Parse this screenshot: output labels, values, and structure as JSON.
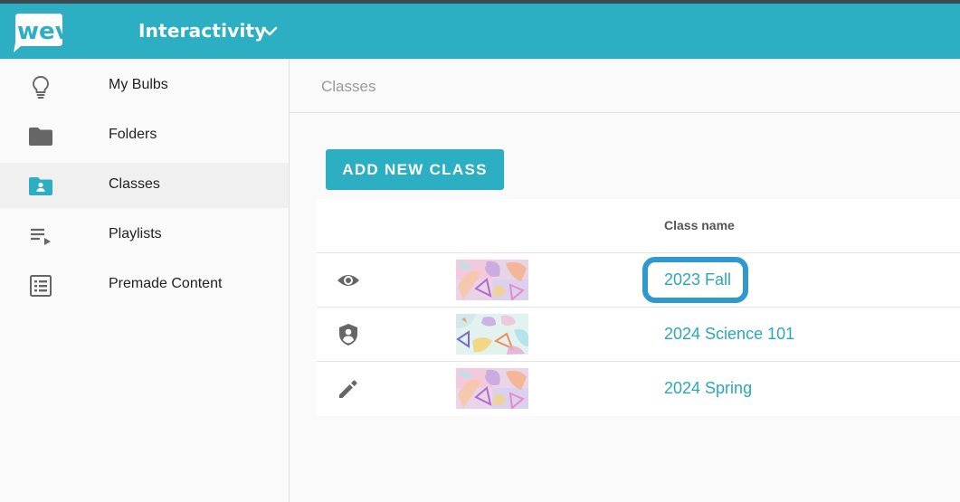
{
  "header": {
    "logo_text": "wevideo",
    "app_title": "Interactivity",
    "brand_color": "#2cafc2"
  },
  "sidebar": {
    "items": [
      {
        "label": "My Bulbs",
        "icon": "lightbulb-icon"
      },
      {
        "label": "Folders",
        "icon": "folder-icon"
      },
      {
        "label": "Classes",
        "icon": "class-folder-icon",
        "active": true
      },
      {
        "label": "Playlists",
        "icon": "playlist-icon"
      },
      {
        "label": "Premade Content",
        "icon": "list-box-icon"
      }
    ]
  },
  "main": {
    "breadcrumb": "Classes",
    "add_button_label": "ADD NEW CLASS",
    "table": {
      "column_header": "Class name",
      "rows": [
        {
          "name": "2023 Fall",
          "role_icon": "eye-icon",
          "highlighted": true
        },
        {
          "name": "2024 Science 101",
          "role_icon": "shield-user-icon"
        },
        {
          "name": "2024 Spring",
          "role_icon": "pencil-icon"
        }
      ]
    }
  }
}
